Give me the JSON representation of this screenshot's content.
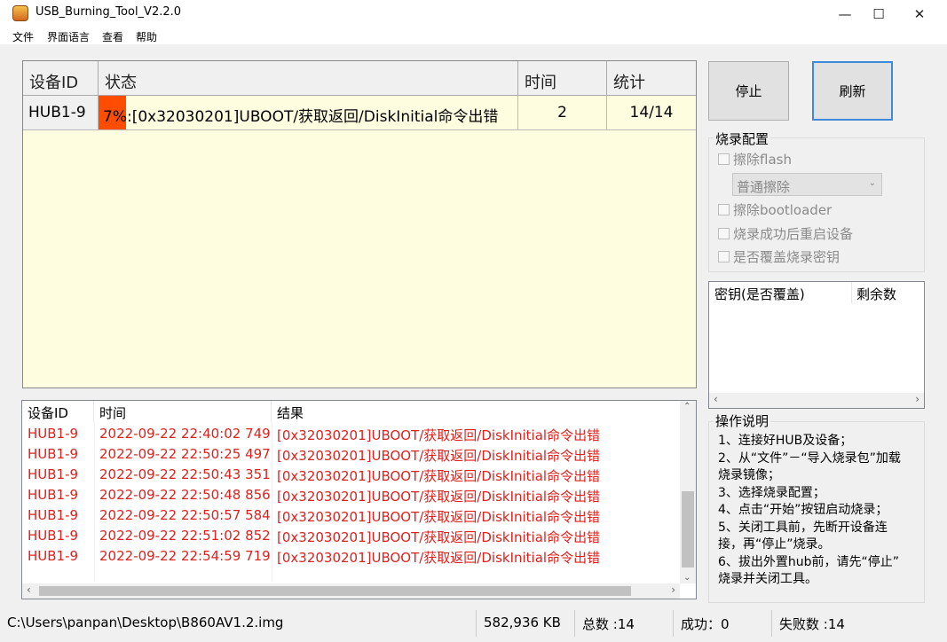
{
  "window": {
    "title": "USB_Burning_Tool_V2.2.0"
  },
  "menu": [
    "文件",
    "界面语言",
    "查看",
    "帮助"
  ],
  "grid": {
    "headers": [
      "设备ID",
      "状态",
      "时间",
      "统计"
    ],
    "rows": [
      {
        "device": "HUB1-9",
        "progress": "7%",
        "status": ":[0x32030201]UBOOT/获取返回/DiskInitial命令出错",
        "time": "2",
        "stats": "14/14"
      }
    ]
  },
  "buttons": {
    "stop": "停止",
    "refresh": "刷新"
  },
  "burn_config": {
    "title": "烧录配置",
    "erase_flash": "擦除flash",
    "erase_mode": "普通擦除",
    "erase_bootloader": "擦除bootloader",
    "reboot_after": "烧录成功后重启设备",
    "overwrite_key": "是否覆盖烧录密钥"
  },
  "key_table": {
    "headers": [
      "密钥(是否覆盖)",
      "剩余数"
    ]
  },
  "log": {
    "headers": [
      "设备ID",
      "时间",
      "结果"
    ],
    "rows": [
      {
        "device": "HUB1-9",
        "time": "2022-09-22 22:40:02 749",
        "result": "[0x32030201]UBOOT/获取返回/DiskInitial命令出错"
      },
      {
        "device": "HUB1-9",
        "time": "2022-09-22 22:50:25 497",
        "result": "[0x32030201]UBOOT/获取返回/DiskInitial命令出错"
      },
      {
        "device": "HUB1-9",
        "time": "2022-09-22 22:50:43 351",
        "result": "[0x32030201]UBOOT/获取返回/DiskInitial命令出错"
      },
      {
        "device": "HUB1-9",
        "time": "2022-09-22 22:50:48 856",
        "result": "[0x32030201]UBOOT/获取返回/DiskInitial命令出错"
      },
      {
        "device": "HUB1-9",
        "time": "2022-09-22 22:50:57 584",
        "result": "[0x32030201]UBOOT/获取返回/DiskInitial命令出错"
      },
      {
        "device": "HUB1-9",
        "time": "2022-09-22 22:51:02 852",
        "result": "[0x32030201]UBOOT/获取返回/DiskInitial命令出错"
      },
      {
        "device": "HUB1-9",
        "time": "2022-09-22 22:54:59 719",
        "result": "[0x32030201]UBOOT/获取返回/DiskInitial命令出错"
      }
    ]
  },
  "instructions": {
    "title": "操作说明",
    "lines": [
      "1、连接好HUB及设备；",
      "2、从“文件”－“导入烧录包”加载",
      "烧录镜像；",
      "3、选择烧录配置；",
      "4、点击“开始”按钮启动烧录；",
      "5、关闭工具前，先断开设备连",
      "接，再“停止”烧录。",
      "6、拔出外置hub前，请先“停止”",
      "烧录并关闭工具。"
    ]
  },
  "status_bar": {
    "path": "C:\\Users\\panpan\\Desktop\\B860AV1.2.img",
    "size": "582,936 KB",
    "total": "总数 :14",
    "success": "成功：0",
    "fail": "失败数 :14"
  },
  "colors": {
    "progress": "#ff4d00",
    "error_text": "#e0201c",
    "grid_bg": "#fffde0",
    "accent": "#3c8ad8"
  }
}
